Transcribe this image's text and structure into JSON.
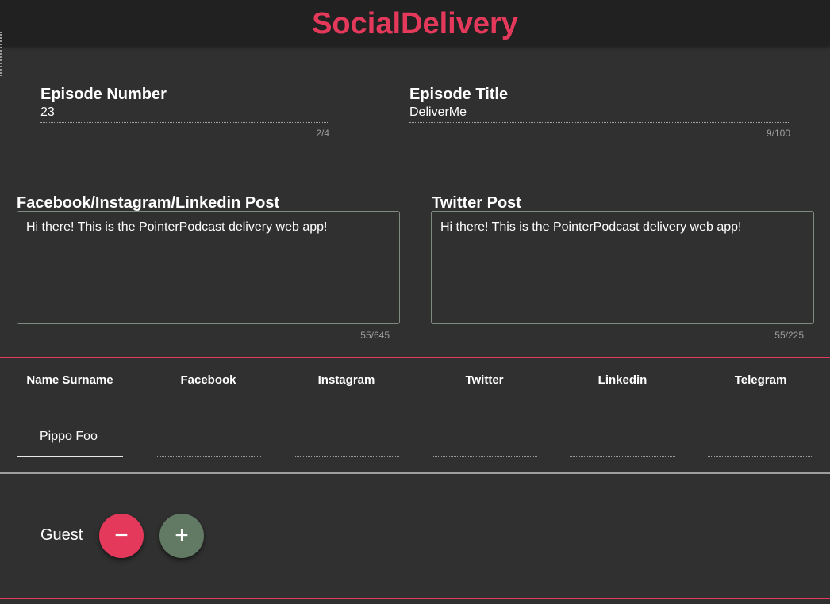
{
  "app": {
    "title": "SocialDelivery"
  },
  "colors": {
    "accent": "#e5395c",
    "add_button": "#627a63",
    "background": "#303030",
    "header": "#212121"
  },
  "episode": {
    "number_label": "Episode Number",
    "number_value": "23",
    "number_counter": "2/4",
    "title_label": "Episode Title",
    "title_value": "DeliverMe",
    "title_counter": "9/100"
  },
  "posts": {
    "social_label": "Facebook/Instagram/Linkedin Post",
    "social_text": "Hi there! This is the PointerPodcast delivery web app!",
    "social_counter": "55/645",
    "twitter_label": "Twitter Post",
    "twitter_text": "Hi there! This is the PointerPodcast delivery web app!",
    "twitter_counter": "55/225"
  },
  "guests_table": {
    "headers": [
      "Name Surname",
      "Facebook",
      "Instagram",
      "Twitter",
      "Linkedin",
      "Telegram"
    ],
    "row": [
      "Pippo Foo",
      "",
      "",
      "",
      "",
      ""
    ]
  },
  "guest_controls": {
    "label": "Guest",
    "remove_icon": "minus-icon",
    "remove_glyph": "−",
    "add_icon": "plus-icon",
    "add_glyph": "+"
  }
}
